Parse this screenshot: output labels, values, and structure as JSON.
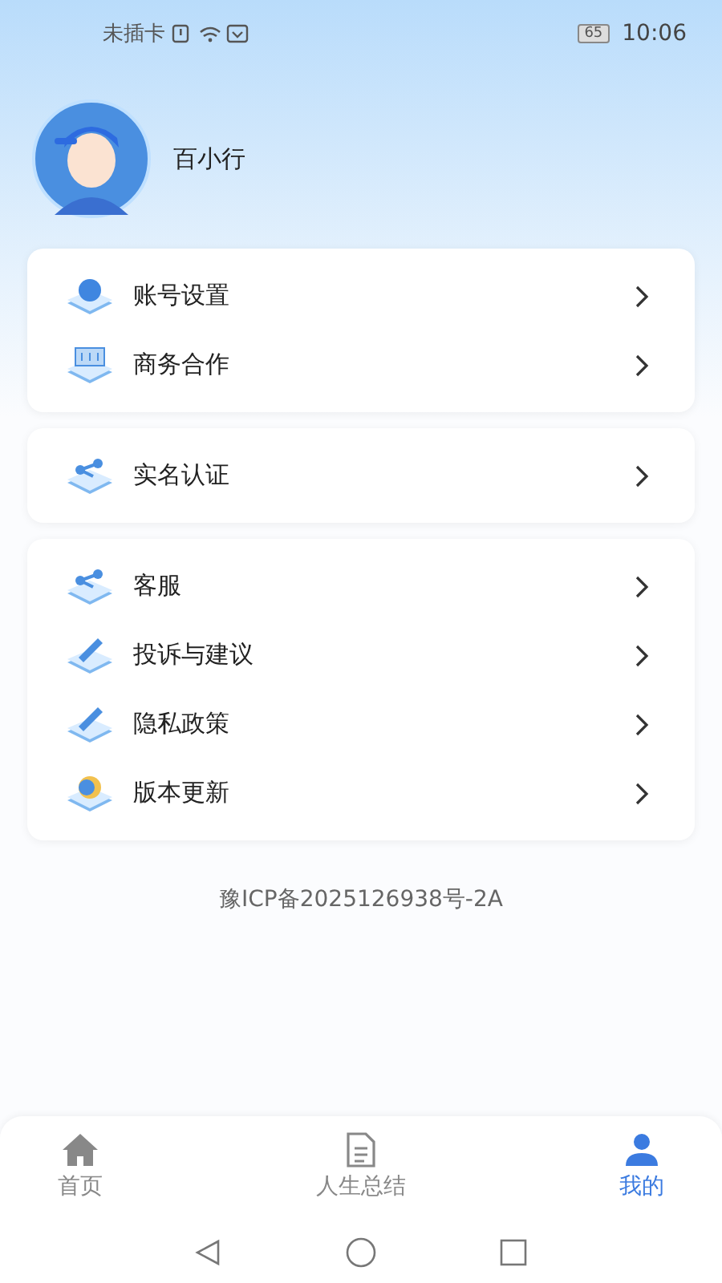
{
  "status_bar": {
    "carrier": "未插卡",
    "battery": "65",
    "time": "10:06"
  },
  "profile": {
    "name": "百小行"
  },
  "menu_groups": [
    {
      "items": [
        {
          "label": "账号设置",
          "kind": "shield"
        },
        {
          "label": "商务合作",
          "kind": "board"
        }
      ]
    },
    {
      "items": [
        {
          "label": "实名认证",
          "kind": "nodes"
        }
      ]
    },
    {
      "items": [
        {
          "label": "客服",
          "kind": "nodes"
        },
        {
          "label": "投诉与建议",
          "kind": "pen"
        },
        {
          "label": "隐私政策",
          "kind": "pen"
        },
        {
          "label": "版本更新",
          "kind": "badge"
        }
      ]
    }
  ],
  "footer_note": "豫ICP备2025126938号-2A",
  "tabs": [
    {
      "label": "首页",
      "kind": "home",
      "selected": false
    },
    {
      "label": "人生总结",
      "kind": "doc",
      "selected": false
    },
    {
      "label": "我的",
      "kind": "person",
      "selected": true
    }
  ]
}
